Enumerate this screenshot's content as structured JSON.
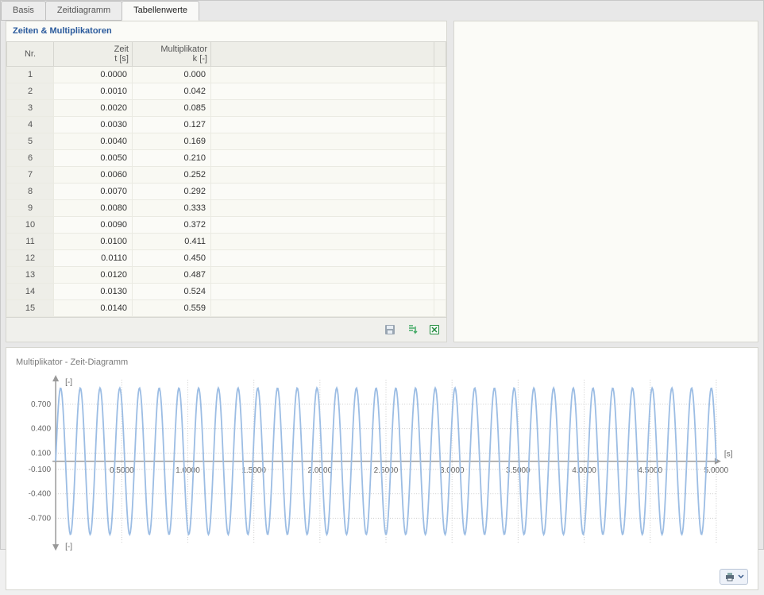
{
  "tabs": [
    "Basis",
    "Zeitdiagramm",
    "Tabellenwerte"
  ],
  "activeTab": 2,
  "panel": {
    "title": "Zeiten & Multiplikatoren"
  },
  "table": {
    "headers": {
      "nr": "Nr.",
      "zeit": "Zeit",
      "zeit_sub": "t [s]",
      "mult": "Multiplikator",
      "mult_sub": "k [-]"
    },
    "rows": [
      {
        "nr": "1",
        "zeit": "0.0000",
        "mult": "0.000"
      },
      {
        "nr": "2",
        "zeit": "0.0010",
        "mult": "0.042"
      },
      {
        "nr": "3",
        "zeit": "0.0020",
        "mult": "0.085"
      },
      {
        "nr": "4",
        "zeit": "0.0030",
        "mult": "0.127"
      },
      {
        "nr": "5",
        "zeit": "0.0040",
        "mult": "0.169"
      },
      {
        "nr": "6",
        "zeit": "0.0050",
        "mult": "0.210"
      },
      {
        "nr": "7",
        "zeit": "0.0060",
        "mult": "0.252"
      },
      {
        "nr": "8",
        "zeit": "0.0070",
        "mult": "0.292"
      },
      {
        "nr": "9",
        "zeit": "0.0080",
        "mult": "0.333"
      },
      {
        "nr": "10",
        "zeit": "0.0090",
        "mult": "0.372"
      },
      {
        "nr": "11",
        "zeit": "0.0100",
        "mult": "0.411"
      },
      {
        "nr": "12",
        "zeit": "0.0110",
        "mult": "0.450"
      },
      {
        "nr": "13",
        "zeit": "0.0120",
        "mult": "0.487"
      },
      {
        "nr": "14",
        "zeit": "0.0130",
        "mult": "0.524"
      },
      {
        "nr": "15",
        "zeit": "0.0140",
        "mult": "0.559"
      }
    ]
  },
  "chart": {
    "title": "Multiplikator - Zeit-Diagramm",
    "y_unit": "[-]",
    "x_unit": "[s]"
  },
  "chart_data": {
    "type": "line",
    "xlabel": "[s]",
    "ylabel": "[-]",
    "xlim": [
      0,
      5.0
    ],
    "ylim": [
      -1.0,
      1.0
    ],
    "xticks": [
      0.5,
      1.0,
      1.5,
      2.0,
      2.5,
      3.0,
      3.5,
      4.0,
      4.5,
      5.0
    ],
    "yticks": [
      -0.7,
      -0.4,
      -0.1,
      0.1,
      0.4,
      0.7
    ],
    "xtick_labels": [
      "0.5000",
      "1.0000",
      "1.5000",
      "2.0000",
      "2.5000",
      "3.0000",
      "3.5000",
      "4.0000",
      "4.5000",
      "5.0000"
    ],
    "ytick_labels": [
      "-0.700",
      "-0.400",
      "-0.100",
      "0.100",
      "0.400",
      "0.700"
    ],
    "series": [
      {
        "name": "k",
        "function": "sin",
        "amplitude": 0.9,
        "frequency_hz": 6.7,
        "x_start": 0,
        "x_end": 5.0,
        "n_points": 1000
      }
    ]
  },
  "footer": {
    "print": "Print"
  }
}
